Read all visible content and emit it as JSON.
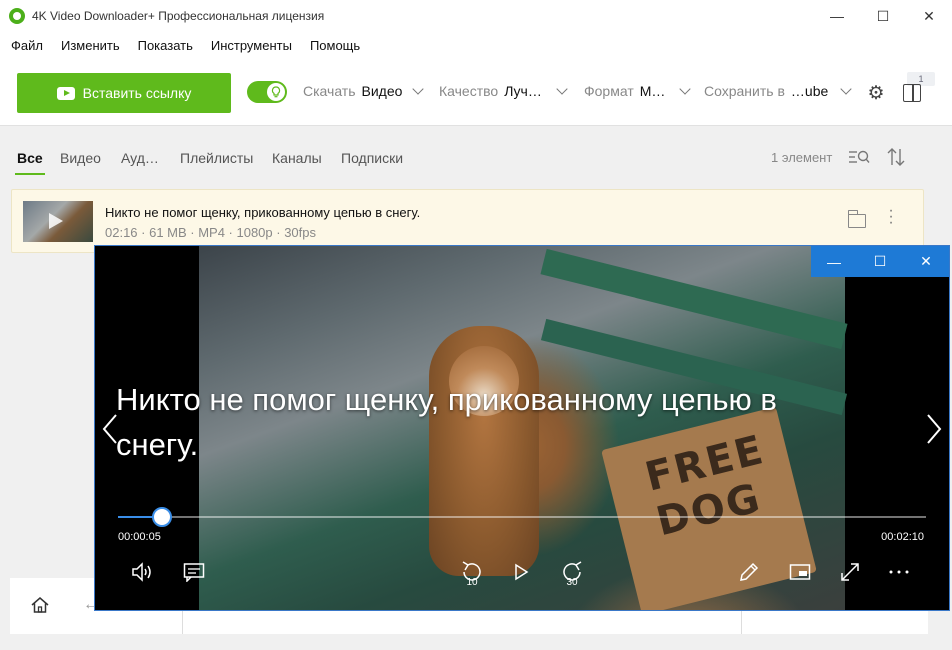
{
  "window": {
    "title": "4K Video Downloader+ Профессиональная лицензия",
    "minimize": "—",
    "maximize": "☐",
    "close": "✕"
  },
  "menu": [
    "Файл",
    "Изменить",
    "Показать",
    "Инструменты",
    "Помощь"
  ],
  "toolbar": {
    "paste_label": "Вставить ссылку",
    "download_label": "Скачать",
    "download_value": "Видео",
    "quality_label": "Качество",
    "quality_value": "Луч…",
    "format_label": "Формат",
    "format_value": "M…",
    "save_label": "Сохранить в",
    "save_value": "…ube",
    "queue_badge": "1"
  },
  "tabs": [
    {
      "label": "Все",
      "active": true
    },
    {
      "label": "Видео",
      "active": false
    },
    {
      "label": "Ауд…",
      "active": false
    },
    {
      "label": "Плейлисты",
      "active": false
    },
    {
      "label": "Каналы",
      "active": false
    },
    {
      "label": "Подписки",
      "active": false
    }
  ],
  "list": {
    "count": "1 элемент",
    "items": [
      {
        "title": "Никто не помог щенку, прикованному цепью в снегу.",
        "meta": "02:16 · 61 MB · MP4 · 1080p · 30fps"
      }
    ]
  },
  "player": {
    "title": "Никто не помог щенку, прикованному цепью в снегу.",
    "time_current": "00:00:05",
    "time_total": "00:02:10",
    "progress": 0.055,
    "skip_back": "10",
    "skip_forward": "30",
    "sign_text": "FREE DOG",
    "minimize": "—",
    "maximize": "☐",
    "close": "✕"
  },
  "colors": {
    "accent": "#5fba1c",
    "player_accent": "#1e7ad6"
  }
}
